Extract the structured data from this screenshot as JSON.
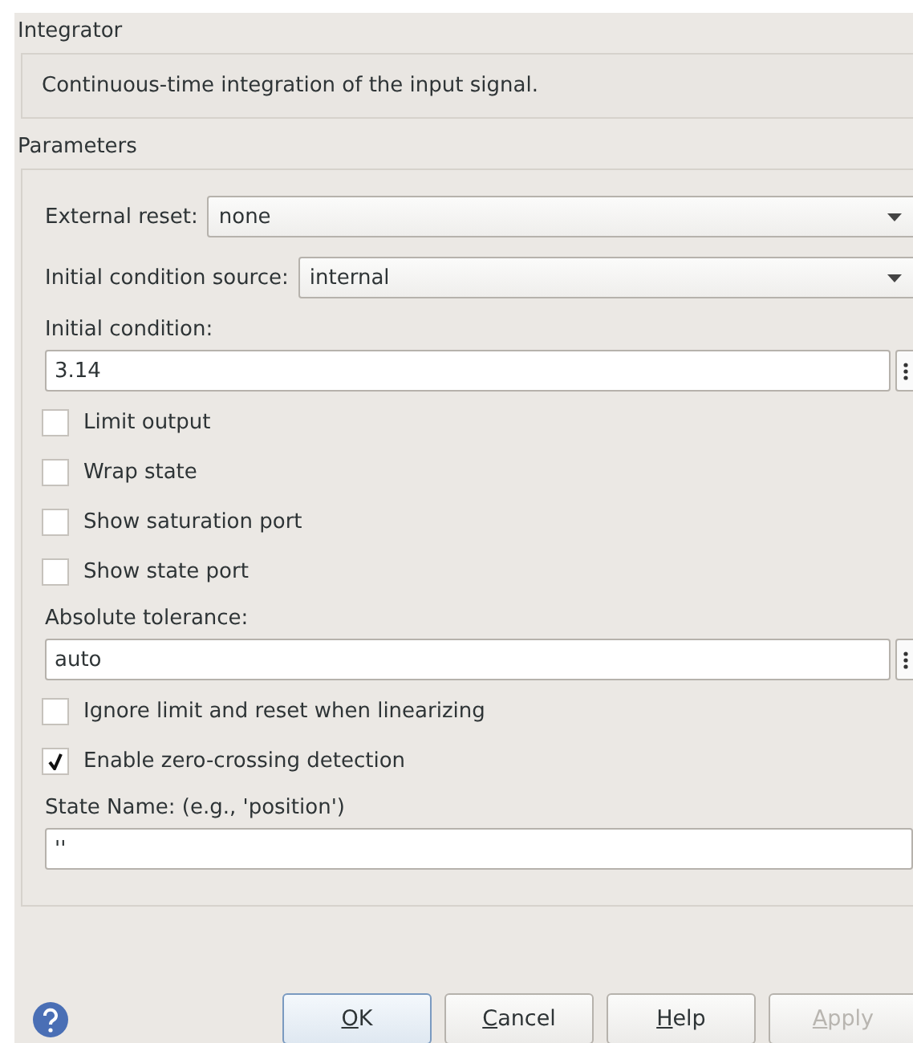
{
  "block": {
    "title": "Integrator",
    "description": "Continuous-time integration of the input signal."
  },
  "parameters": {
    "title": "Parameters",
    "items": [
      {
        "kind": "dropdown",
        "label": "External reset:",
        "value": "none"
      },
      {
        "kind": "dropdown",
        "label": "Initial condition source:",
        "value": "internal"
      },
      {
        "kind": "field",
        "label": "Initial condition:",
        "value": "3.14",
        "menu": true
      },
      {
        "kind": "checkbox",
        "label": "Limit output",
        "checked": false
      },
      {
        "kind": "checkbox",
        "label": "Wrap state",
        "checked": false
      },
      {
        "kind": "checkbox",
        "label": "Show saturation port",
        "checked": false
      },
      {
        "kind": "checkbox",
        "label": "Show state port",
        "checked": false
      },
      {
        "kind": "field",
        "label": "Absolute tolerance:",
        "value": "auto",
        "menu": true
      },
      {
        "kind": "checkbox",
        "label": "Ignore limit and reset when linearizing",
        "checked": false
      },
      {
        "kind": "checkbox",
        "label": "Enable zero-crossing detection",
        "checked": true
      },
      {
        "kind": "field",
        "label": "State Name: (e.g., 'position')",
        "value": "''",
        "menu": false
      }
    ]
  },
  "buttons": [
    {
      "label": "OK",
      "underline_first": true,
      "disabled": false,
      "default": true
    },
    {
      "label": "Cancel",
      "underline_first": true,
      "disabled": false,
      "default": false
    },
    {
      "label": "Help",
      "underline_first": true,
      "disabled": false,
      "default": false
    },
    {
      "label": "Apply",
      "underline_first": true,
      "disabled": true,
      "default": false
    }
  ]
}
